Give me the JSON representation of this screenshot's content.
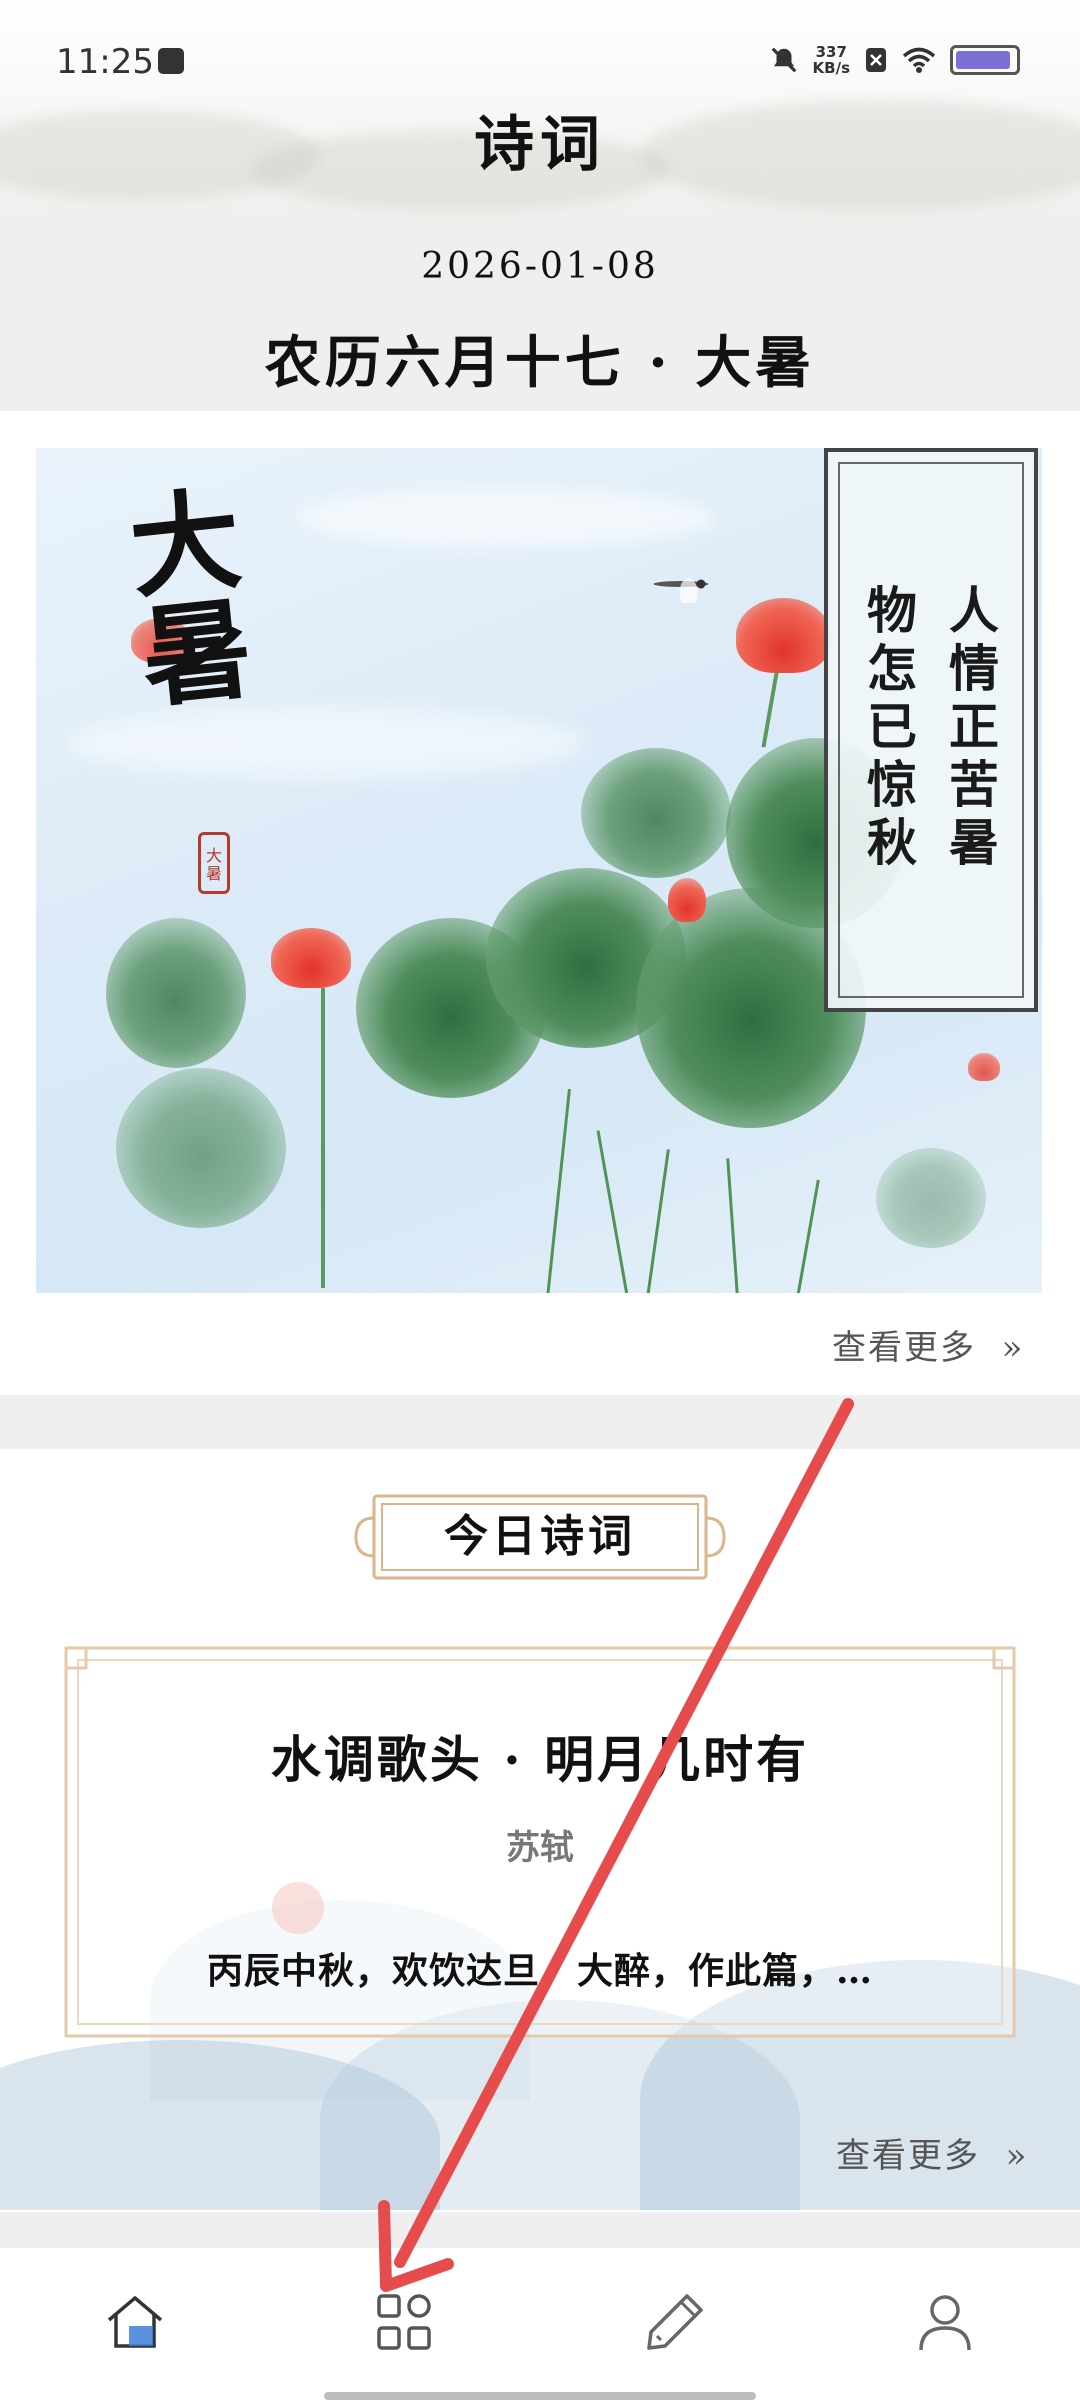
{
  "status_bar": {
    "time": "11:25",
    "network_speed_value": "337",
    "network_speed_unit": "KB/s",
    "icons": [
      "message-icon",
      "mute-icon",
      "sim-off-icon",
      "wifi-icon",
      "battery-icon"
    ]
  },
  "header": {
    "title": "诗词"
  },
  "date_bar": {
    "date": "2026-01-08",
    "lunar": "农历六月十七 · 大暑"
  },
  "banner": {
    "calligraphy": "大暑",
    "seal_text": "大暑",
    "poem_right_column": "人情正苦暑",
    "poem_left_column": "物怎已惊秋",
    "more_label": "查看更多"
  },
  "daily_poem": {
    "section_title": "今日诗词",
    "title": "水调歌头 · 明月几时有",
    "author": "苏轼",
    "excerpt": "丙辰中秋，欢饮达旦，大醉，作此篇，…",
    "more_label": "查看更多"
  },
  "bottom_nav": {
    "items": [
      "home-icon",
      "categories-icon",
      "write-icon",
      "profile-icon"
    ],
    "active": "home-icon",
    "accent": "#3d7fd9"
  },
  "annotation": {
    "arrow_color": "#e74c4c"
  }
}
